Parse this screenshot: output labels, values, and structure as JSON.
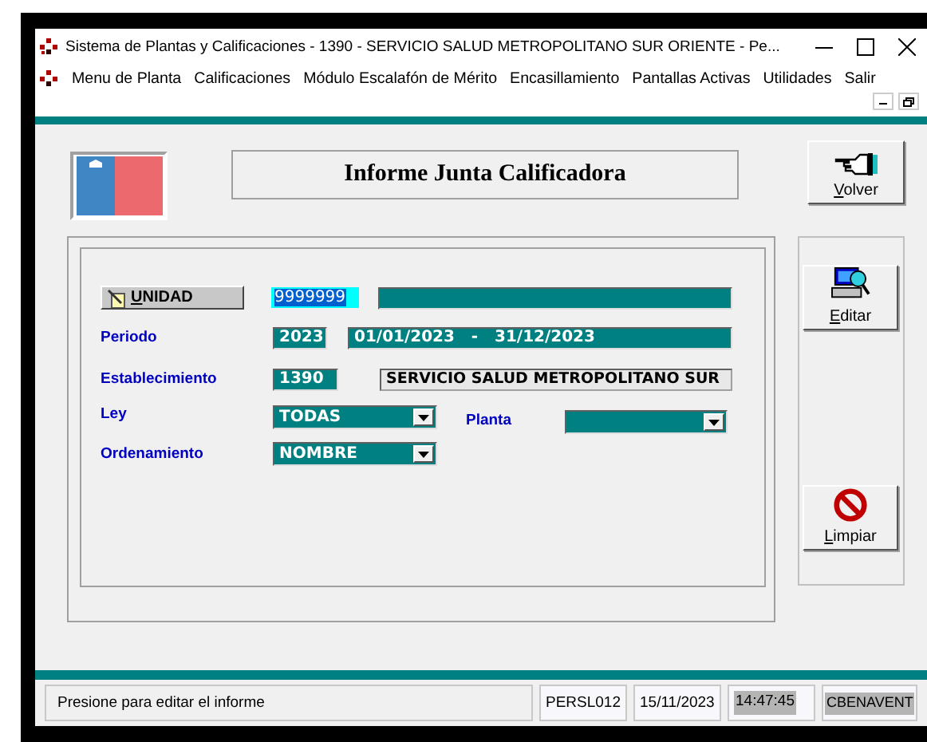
{
  "window": {
    "title": "Sistema de Plantas y Calificaciones - 1390 - SERVICIO SALUD METROPOLITANO SUR ORIENTE - Pe..."
  },
  "menu": [
    "Menu de Planta",
    "Calificaciones",
    "Módulo Escalafón de Mérito",
    "Encasillamiento",
    "Pantallas Activas",
    "Utilidades",
    "Salir"
  ],
  "header": {
    "title": "Informe Junta Calificadora"
  },
  "buttons": [
    {
      "kind": "back",
      "label": "Volver"
    },
    {
      "kind": "edit",
      "label": "Editar"
    },
    {
      "kind": "clear",
      "label": "Limpiar"
    }
  ],
  "form": {
    "unidad": {
      "button": "UNIDAD",
      "code": "9999999",
      "code_selected": true
    },
    "periodo": {
      "label": "Periodo",
      "year": "2023",
      "range": "01/01/2023   -   31/12/2023"
    },
    "establecimiento": {
      "label": "Establecimiento",
      "code": "1390",
      "name": "SERVICIO SALUD METROPOLITANO SUR"
    },
    "ley": {
      "label": "Ley",
      "value": "TODAS"
    },
    "planta": {
      "label": "Planta"
    },
    "ordenamiento": {
      "label": "Ordenamiento",
      "value": "NOMBRE"
    }
  },
  "status_bar": [
    {
      "kind": "message",
      "text": "Presione para editar el informe"
    },
    {
      "kind": "plain",
      "text": "PERSL012"
    },
    {
      "kind": "plain",
      "text": "15/11/2023"
    },
    {
      "kind": "shaded",
      "text": "14:47:45"
    },
    {
      "kind": "shaded",
      "text": "CBENAVENT"
    }
  ]
}
